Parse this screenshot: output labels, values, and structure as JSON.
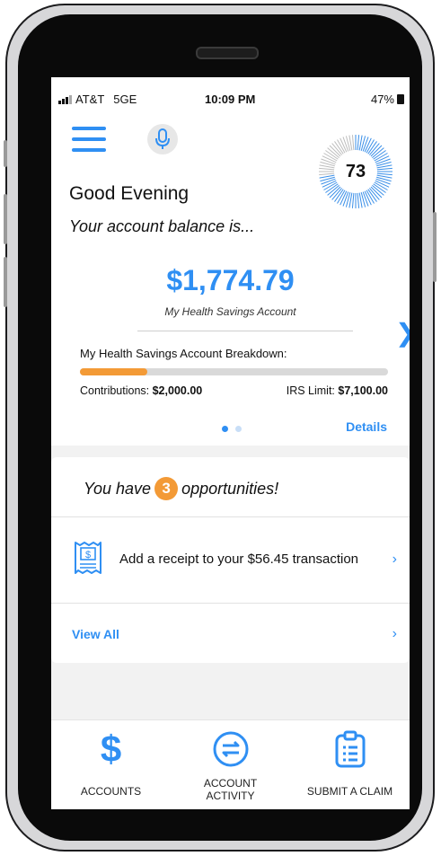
{
  "status_bar": {
    "carrier": "AT&T",
    "network": "5GE",
    "time": "10:09 PM",
    "battery": "47%"
  },
  "header": {
    "menu_icon": "hamburger-menu-icon",
    "mic_icon": "microphone-icon",
    "score": "73"
  },
  "greeting": {
    "title": "Good Evening",
    "subtitle": "Your account balance is..."
  },
  "account": {
    "balance": "$1,774.79",
    "name": "My Health Savings Account",
    "breakdown_title": "My Health Savings Account Breakdown:",
    "contributions_label": "Contributions:",
    "contributions_value": "$2,000.00",
    "irs_label": "IRS Limit:",
    "irs_value": "$7,100.00",
    "progress_fraction": 0.22,
    "details_link": "Details",
    "carousel_pages": 2,
    "carousel_active": 0
  },
  "opportunities": {
    "prefix": "You have",
    "count": "3",
    "suffix": "opportunities!",
    "items": [
      {
        "icon": "receipt-icon",
        "text": "Add a receipt to your $56.45 transaction",
        "chevron": "›"
      }
    ],
    "view_all": "View All",
    "view_all_chevron": "›"
  },
  "tabbar": {
    "tabs": [
      {
        "label": "ACCOUNTS",
        "icon": "dollar-icon"
      },
      {
        "label_line1": "ACCOUNT",
        "label_line2": "ACTIVITY",
        "icon": "exchange-arrows-icon"
      },
      {
        "label": "SUBMIT A CLAIM",
        "icon": "clipboard-icon"
      }
    ]
  },
  "colors": {
    "accent": "#2f8ff3",
    "orange": "#f39a36",
    "background": "#f2f2f2"
  }
}
